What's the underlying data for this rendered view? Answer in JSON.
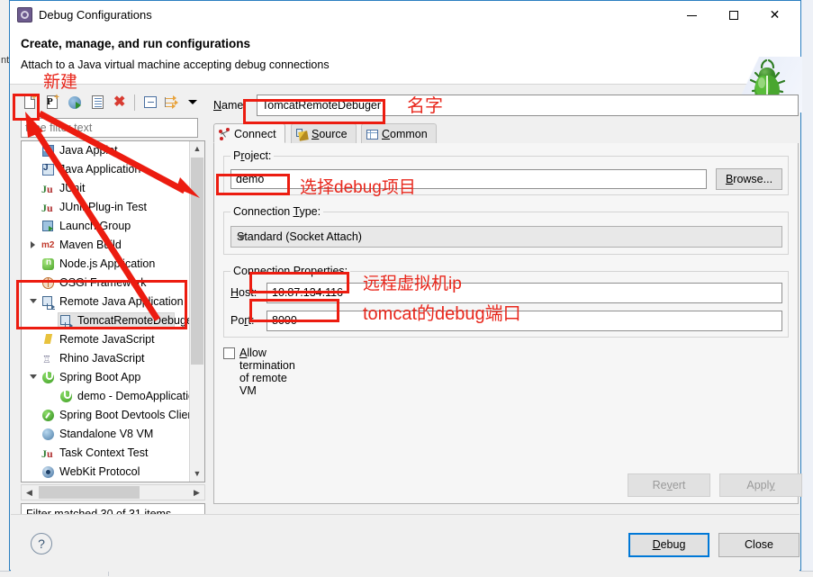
{
  "window": {
    "title": "Debug Configurations",
    "icon": "debug-configurations-icon",
    "minimize": "—",
    "maximize": "□",
    "close": "✕"
  },
  "header": {
    "title": "Create, manage, and run configurations",
    "subtitle": "Attach to a Java virtual machine accepting debug connections",
    "decoration_icon": "green-bug-icon"
  },
  "left": {
    "toolbar": [
      {
        "name": "new-launch-configuration",
        "tooltip": "New launch configuration"
      },
      {
        "name": "new-prototype",
        "tooltip": "New prototype"
      },
      {
        "name": "duplicate-configuration",
        "tooltip": "Duplicate"
      },
      {
        "name": "export-configuration",
        "tooltip": "Export"
      },
      {
        "name": "delete-configuration",
        "tooltip": "Delete"
      },
      {
        "name": "collapse-all",
        "tooltip": "Collapse All"
      },
      {
        "name": "filter-configurations",
        "tooltip": "Filter"
      },
      {
        "name": "view-menu",
        "tooltip": "View Menu"
      }
    ],
    "filter_placeholder": "type filter text",
    "tree": [
      {
        "label": "Java Applet",
        "icon": "java-applet-icon",
        "indent": 0,
        "twisty": "none",
        "selected": false
      },
      {
        "label": "Java Application",
        "icon": "java-application-icon",
        "indent": 0,
        "twisty": "none",
        "selected": false
      },
      {
        "label": "JUnit",
        "icon": "junit-icon",
        "indent": 0,
        "twisty": "none",
        "selected": false
      },
      {
        "label": "JUnit Plug-in Test",
        "icon": "junit-plugin-icon",
        "indent": 0,
        "twisty": "none",
        "selected": false
      },
      {
        "label": "Launch Group",
        "icon": "launch-group-icon",
        "indent": 0,
        "twisty": "none",
        "selected": false
      },
      {
        "label": "Maven Build",
        "icon": "maven-icon",
        "indent": 0,
        "twisty": "closed",
        "selected": false
      },
      {
        "label": "Node.js Application",
        "icon": "nodejs-icon",
        "indent": 0,
        "twisty": "none",
        "selected": false
      },
      {
        "label": "OSGi Framework",
        "icon": "osgi-icon",
        "indent": 0,
        "twisty": "none",
        "selected": false
      },
      {
        "label": "Remote Java Application",
        "icon": "remote-java-application-icon",
        "indent": 0,
        "twisty": "open",
        "selected": false
      },
      {
        "label": "TomcatRemoteDebuger",
        "icon": "remote-java-application-icon",
        "indent": 1,
        "twisty": "none",
        "selected": true
      },
      {
        "label": "Remote JavaScript",
        "icon": "remote-javascript-icon",
        "indent": 0,
        "twisty": "none",
        "selected": false
      },
      {
        "label": "Rhino JavaScript",
        "icon": "rhino-icon",
        "indent": 0,
        "twisty": "none",
        "selected": false
      },
      {
        "label": "Spring Boot App",
        "icon": "spring-boot-icon",
        "indent": 0,
        "twisty": "open",
        "selected": false
      },
      {
        "label": "demo - DemoApplication",
        "icon": "spring-boot-icon",
        "indent": 1,
        "twisty": "none",
        "selected": false
      },
      {
        "label": "Spring Boot Devtools Client",
        "icon": "spring-devtools-icon",
        "indent": 0,
        "twisty": "none",
        "selected": false
      },
      {
        "label": "Standalone V8 VM",
        "icon": "v8-icon",
        "indent": 0,
        "twisty": "none",
        "selected": false
      },
      {
        "label": "Task Context Test",
        "icon": "junit-icon",
        "indent": 0,
        "twisty": "none",
        "selected": false
      },
      {
        "label": "WebKit Protocol",
        "icon": "webkit-icon",
        "indent": 0,
        "twisty": "none",
        "selected": false
      }
    ],
    "status": "Filter matched 30 of 31 items"
  },
  "right": {
    "name_label": "Name:",
    "name_value": "TomcatRemoteDebuger",
    "tabs": [
      {
        "label": "Connect",
        "icon": "connect-icon",
        "active": true
      },
      {
        "label": "Source",
        "icon": "source-pencil-icon",
        "active": false
      },
      {
        "label": "Common",
        "icon": "common-table-icon",
        "active": false
      }
    ],
    "project": {
      "group_label": "Project:",
      "value": "demo",
      "browse_label": "Browse..."
    },
    "connection_type": {
      "group_label": "Connection Type:",
      "value": "Standard (Socket Attach)"
    },
    "connection_properties": {
      "group_label": "Connection Properties:",
      "host_label": "Host:",
      "host_value": "10.87.134.116",
      "port_label": "Port:",
      "port_value": "8000"
    },
    "allow_termination": {
      "label": "Allow termination of remote VM",
      "checked": false
    },
    "revert_label": "Revert",
    "apply_label": "Apply"
  },
  "footer": {
    "help_label": "?",
    "debug_label": "Debug",
    "close_label": "Close"
  },
  "annotations": [
    {
      "name": "annotation-new",
      "text": "新建"
    },
    {
      "name": "annotation-name",
      "text": "名字"
    },
    {
      "name": "annotation-project",
      "text": "选择debug项目"
    },
    {
      "name": "annotation-host",
      "text": "远程虚拟机ip"
    },
    {
      "name": "annotation-port",
      "text": "tomcat的debug端口"
    }
  ],
  "background": {
    "left_text": "nt"
  },
  "colors": {
    "annotation_red": "#ec1c10",
    "window_border_blue": "#2a7ec0",
    "default_button_blue": "#0078d7",
    "dialog_bg": "#f0f0f0",
    "panel_bg": "#f6f6f6"
  }
}
